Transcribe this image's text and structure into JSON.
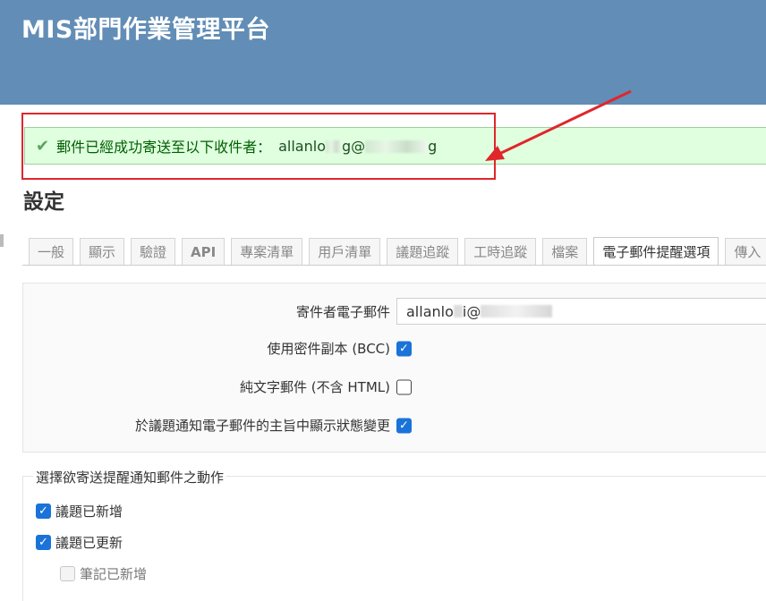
{
  "header": {
    "title": "MIS部門作業管理平台"
  },
  "flash": {
    "message": "郵件已經成功寄送至以下收件者：",
    "email_prefix": "allanlo",
    "email_mid": "g@",
    "email_suffix": "g"
  },
  "page_title": "設定",
  "tabs": [
    {
      "label": "一般"
    },
    {
      "label": "顯示"
    },
    {
      "label": "驗證"
    },
    {
      "label": "API"
    },
    {
      "label": "專案清單"
    },
    {
      "label": "用戶清單"
    },
    {
      "label": "議題追蹤"
    },
    {
      "label": "工時追蹤"
    },
    {
      "label": "檔案"
    },
    {
      "label": "電子郵件提醒選項"
    },
    {
      "label": "傳入"
    }
  ],
  "settings": {
    "sender_email_label": "寄件者電子郵件",
    "sender_email_value_prefix": "allanlo",
    "sender_email_value_suffix": "i@",
    "bcc_label": "使用密件副本 (BCC)",
    "plain_text_label": "純文字郵件 (不含 HTML)",
    "status_subject_label": "於議題通知電子郵件的主旨中顯示狀態變更"
  },
  "actions": {
    "legend": "選擇欲寄送提醒通知郵件之動作",
    "issue_added": "議題已新增",
    "issue_updated": "議題已更新",
    "note_added": "筆記已新增"
  },
  "colors": {
    "header_bg": "#628db6",
    "success_bg": "#dfffdf",
    "annotation": "#e0262b",
    "checkbox": "#1a73d9"
  }
}
